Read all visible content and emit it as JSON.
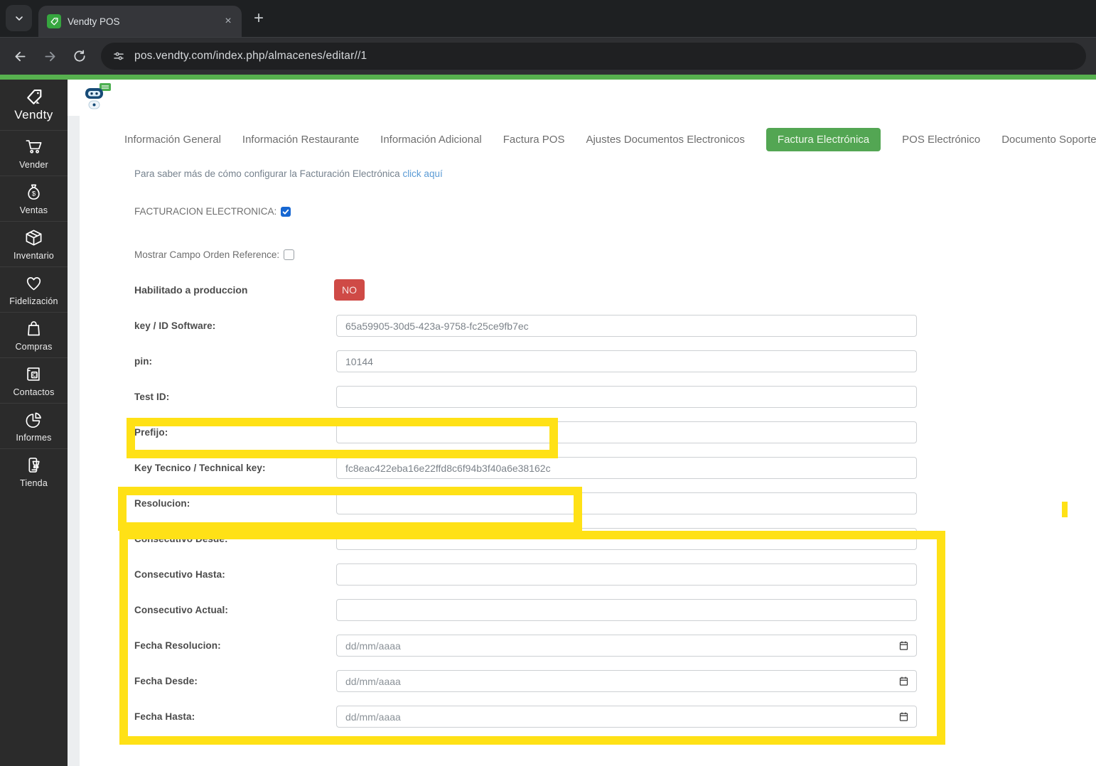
{
  "browser": {
    "tab": {
      "title": "Vendty POS",
      "close_label": "×"
    },
    "new_tab_label": "+",
    "address": {
      "url": "pos.vendty.com/index.php/almacenes/editar//1"
    }
  },
  "sidebar": {
    "brand": "Vendty",
    "items": [
      {
        "label": "Vender",
        "icon": "cart-icon"
      },
      {
        "label": "Ventas",
        "icon": "money-bag-icon"
      },
      {
        "label": "Inventario",
        "icon": "box-icon"
      },
      {
        "label": "Fidelización",
        "icon": "heart-icon"
      },
      {
        "label": "Compras",
        "icon": "shopping-bag-icon"
      },
      {
        "label": "Contactos",
        "icon": "contacts-book-icon"
      },
      {
        "label": "Informes",
        "icon": "pie-chart-icon"
      },
      {
        "label": "Tienda",
        "icon": "store-icon"
      }
    ]
  },
  "tabs": {
    "items": [
      "Información General",
      "Información Restaurante",
      "Información Adicional",
      "Factura POS",
      "Ajustes Documentos Electronicos",
      "Factura Electrónica",
      "POS Electrónico",
      "Documento Soporte"
    ],
    "active": "Factura Electrónica"
  },
  "help": {
    "prefix": "Para saber más de cómo configurar la Facturación Electrónica ",
    "link": "click aquí"
  },
  "checkboxes": {
    "facturacion": {
      "label": "FACTURACION ELECTRONICA:",
      "checked": true
    },
    "orden_reference": {
      "label": "Mostrar Campo Orden Reference:",
      "checked": false
    }
  },
  "production": {
    "label": "Habilitado a produccion",
    "value": "NO"
  },
  "form": {
    "rows": [
      {
        "label": "key / ID Software:",
        "value": "65a59905-30d5-423a-9758-fc25ce9fb7ec",
        "type": "text"
      },
      {
        "label": "pin:",
        "value": "10144",
        "type": "text"
      },
      {
        "label": "Test ID:",
        "value": "",
        "type": "text"
      },
      {
        "label": "Prefijo:",
        "value": "",
        "type": "text"
      },
      {
        "label": "Key Tecnico / Technical key:",
        "value": "fc8eac422eba16e22ffd8c6f94b3f40a6e38162c",
        "type": "text"
      },
      {
        "label": "Resolucion:",
        "value": "",
        "type": "text"
      },
      {
        "label": "Consecutivo Desde:",
        "value": "",
        "type": "text"
      },
      {
        "label": "Consecutivo Hasta:",
        "value": "",
        "type": "text"
      },
      {
        "label": "Consecutivo Actual:",
        "value": "",
        "type": "text"
      },
      {
        "label": "Fecha Resolucion:",
        "placeholder": "dd/mm/aaaa",
        "type": "date"
      },
      {
        "label": "Fecha Desde:",
        "placeholder": "dd/mm/aaaa",
        "type": "date"
      },
      {
        "label": "Fecha Hasta:",
        "placeholder": "dd/mm/aaaa",
        "type": "date"
      }
    ]
  },
  "colors": {
    "brand_bar_green": "#57b14f",
    "active_tab_green": "#53a653",
    "danger_red": "#cf4a46",
    "link_blue": "#5b9bd5",
    "checkbox_blue": "#1767d2",
    "highlight_yellow": "#ffe116"
  }
}
